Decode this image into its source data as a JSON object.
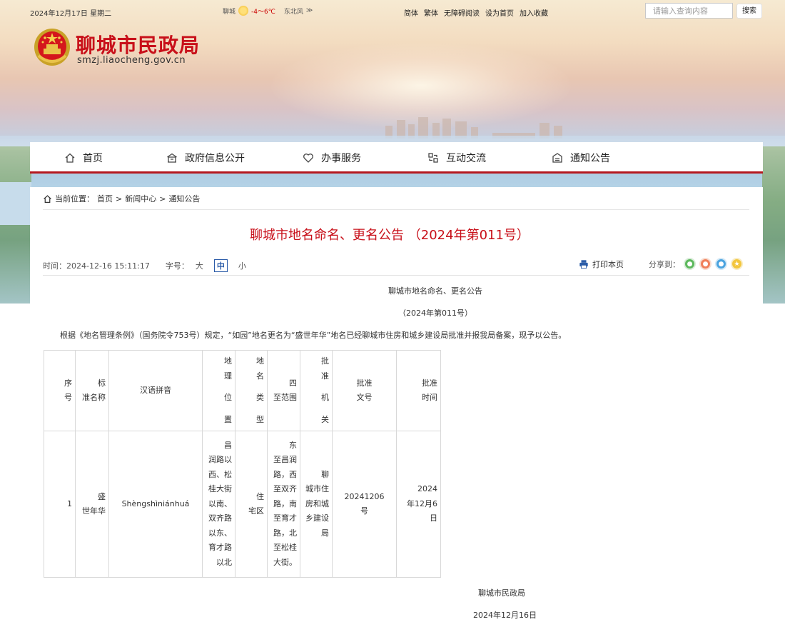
{
  "topbar": {
    "date": "2024年12月17日 星期二",
    "weather_city": "聊城",
    "weather_temp": "-4～6℃",
    "weather_wind": "东北风",
    "wind_arrow": "≫",
    "links": [
      "简体",
      "繁体",
      "无障碍阅读",
      "设为首页",
      "加入收藏"
    ],
    "search_placeholder": "请输入查询内容",
    "search_button": "搜索"
  },
  "site": {
    "title": "聊城市民政局",
    "domain": "smzj.liaocheng.gov.cn",
    "brand_color": "#c8101a"
  },
  "nav": {
    "items": [
      {
        "label": "首页",
        "icon": "home-icon"
      },
      {
        "label": "政府信息公开",
        "icon": "building-icon"
      },
      {
        "label": "办事服务",
        "icon": "heart-icon"
      },
      {
        "label": "互动交流",
        "icon": "interaction-icon"
      },
      {
        "label": "通知公告",
        "icon": "notice-icon"
      }
    ],
    "accent_color": "#b5171e"
  },
  "breadcrumb": {
    "prefix": "当前位置：",
    "items": [
      "首页",
      "新闻中心",
      "通知公告"
    ],
    "separator": ">"
  },
  "article": {
    "title": "聊城市地名命名、更名公告 （2024年第011号）",
    "time_label": "时间：",
    "time": "2024-12-16 15:11:17",
    "font_size_label": "字号：",
    "font_sizes": [
      "大",
      "中",
      "小"
    ],
    "active_font_size": "中",
    "print_label": "打印本页",
    "share_label": "分享到：",
    "share_icons": [
      "wechat-icon",
      "weibo-icon",
      "qq-icon",
      "qzone-icon"
    ]
  },
  "announcement": {
    "heading": "聊城市地名命名、更名公告",
    "number": "（2024年第011号）",
    "paragraph": "根据《地名管理条例》（国务院令753号）规定，“如园”地名更名为“盛世年华”地名已经聊城市住房和城乡建设局批准并报我局备案，现予以公告。",
    "table": {
      "headers": [
        [
          "序",
          "号"
        ],
        [
          "标",
          "准名称"
        ],
        [
          "汉语拼音"
        ],
        [
          "地",
          "理",
          "位",
          "置"
        ],
        [
          "地",
          "名",
          "类",
          "型"
        ],
        [
          "四",
          "至范围"
        ],
        [
          "批",
          "准",
          "机",
          "关"
        ],
        [
          "批准",
          "文号"
        ],
        [
          "批准",
          "时间"
        ]
      ],
      "rows": [
        [
          [
            "1"
          ],
          [
            "盛",
            "世年华"
          ],
          [
            "Shèngshìniánhuá"
          ],
          [
            "昌",
            "润路以",
            "西、松",
            "桂大街",
            "以南、",
            "双齐路",
            "以东、",
            "育才路",
            "以北"
          ],
          [
            "住",
            "宅区"
          ],
          [
            "东",
            "至昌润",
            "路，西",
            "至双齐",
            "路，南",
            "至育才",
            "路，北",
            "至松桂",
            "大街。"
          ],
          [
            "聊",
            "城市住",
            "房和城",
            "乡建设",
            "局"
          ],
          [
            "20241206",
            "号"
          ],
          [
            "2024",
            "年12月6",
            "日"
          ]
        ]
      ]
    },
    "signature_org": "聊城市民政局",
    "signature_date": "2024年12月16日"
  }
}
